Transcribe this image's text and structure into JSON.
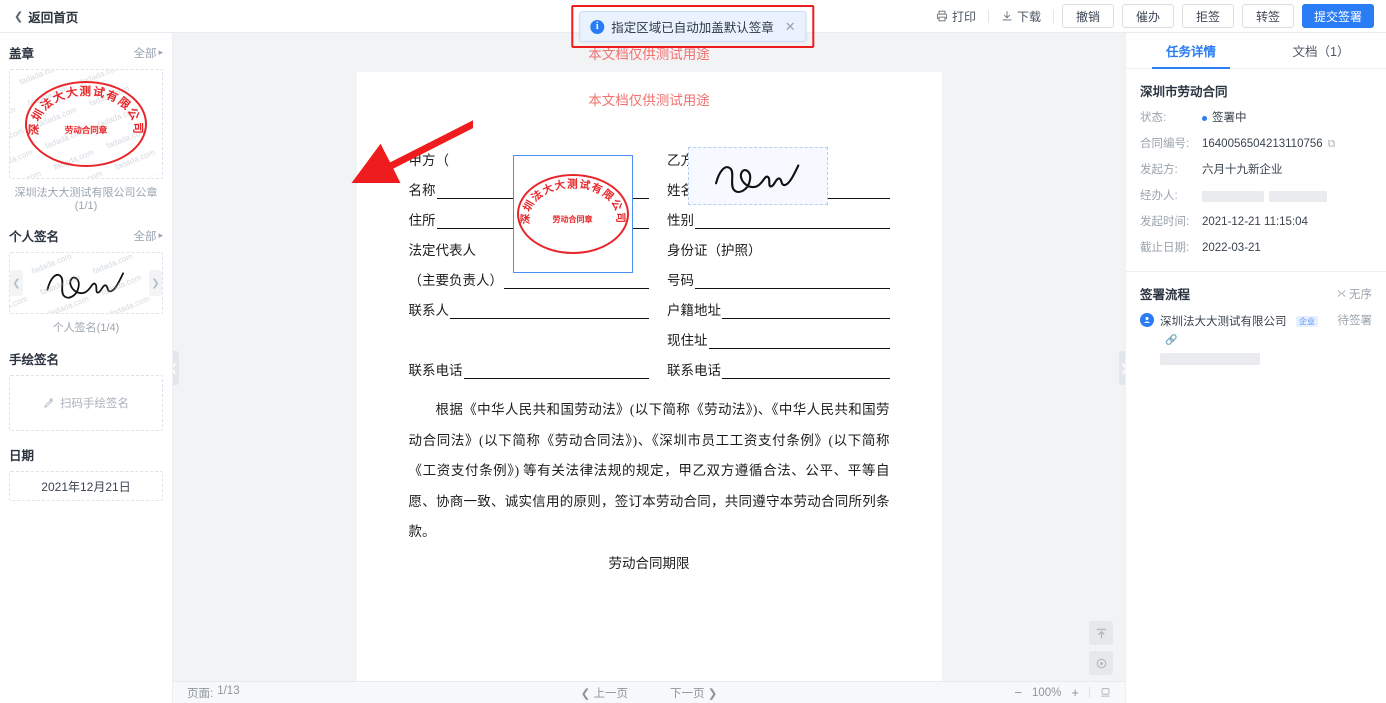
{
  "topbar": {
    "back_label": "返回首页",
    "print_label": "打印",
    "download_label": "下载",
    "buttons": [
      {
        "label": "撤销",
        "primary": false
      },
      {
        "label": "催办",
        "primary": false
      },
      {
        "label": "拒签",
        "primary": false
      },
      {
        "label": "转签",
        "primary": false
      },
      {
        "label": "提交签署",
        "primary": true
      }
    ]
  },
  "toast": {
    "message": "指定区域已自动加盖默认签章",
    "close": "✕",
    "info": "i",
    "border_color": "#ee1c1c"
  },
  "left_panel": {
    "seal_section": {
      "title": "盖章",
      "all": "全部",
      "caption": "深圳法大大测试有限公司公章(1/1)"
    },
    "seal": {
      "top_text": "深圳法大大测试有限公司",
      "center_text": "劳动合同章",
      "color": "#e8262a"
    },
    "signature_section": {
      "title": "个人签名",
      "all": "全部",
      "caption": "个人签名(1/4)"
    },
    "handdraw_section": {
      "title": "手绘签名",
      "action_label": "扫码手绘签名"
    },
    "date_section": {
      "title": "日期",
      "value": "2021年12月21日"
    },
    "watermark": "fadada.com"
  },
  "viewer": {
    "watermark_top": "本文档仅供测试用途",
    "watermark_page": "本文档仅供测试用途",
    "doc": {
      "left_column": [
        {
          "label": "甲方（",
          "line": false
        },
        {
          "label": "名称",
          "line": true
        },
        {
          "label": "住所",
          "line": true
        },
        {
          "label": "法定代表人",
          "line": false
        },
        {
          "label": "（主要负责人）",
          "line": true
        },
        {
          "label": "联系人",
          "line": true
        },
        {
          "label": "",
          "line": false
        },
        {
          "label": "联系电话",
          "line": true
        }
      ],
      "right_column": [
        {
          "label": "乙方(员工)",
          "line": false
        },
        {
          "label": "姓名",
          "line": true
        },
        {
          "label": "性别",
          "line": true
        },
        {
          "label": "身份证（护照）",
          "line": false
        },
        {
          "label": "号码",
          "line": true
        },
        {
          "label": "户籍地址",
          "line": true
        },
        {
          "label": "现住址",
          "line": true
        },
        {
          "label": "联系电话",
          "line": true
        }
      ],
      "paragraph": "根据《中华人民共和国劳动法》(以下简称《劳动法》)、《中华人民共和国劳动合同法》(以下简称《劳动合同法》)、《深圳市员工工资支付条例》(以下简称《工资支付条例》) 等有关法律法规的规定，甲乙双方遵循合法、公平、平等自愿、协商一致、诚实信用的原则，签订本劳动合同，共同遵守本劳动合同所列条款。",
      "next_heading": "劳动合同期限"
    },
    "float_buttons": [
      {
        "name": "scroll-top",
        "glyph": "⬆"
      },
      {
        "name": "locate",
        "glyph": "◎"
      }
    ]
  },
  "bottombar": {
    "page_label": "页面:",
    "page_value": "1/13",
    "prev_label": "上一页",
    "next_label": "下一页",
    "zoom_out": "−",
    "zoom_value": "100%",
    "zoom_in": "+",
    "fit_icon": "⎙"
  },
  "right_panel": {
    "tabs": [
      {
        "label": "任务详情",
        "active": true
      },
      {
        "label": "文档（1）",
        "active": false
      }
    ],
    "doc_title": "深圳市劳动合同",
    "details": [
      {
        "key": "状态:",
        "value": "签署中",
        "type": "status"
      },
      {
        "key": "合同编号:",
        "value": "1640056504213110756",
        "type": "copyable"
      },
      {
        "key": "发起方:",
        "value": "六月十九新企业",
        "type": "text"
      },
      {
        "key": "经办人:",
        "value": "",
        "type": "masked"
      },
      {
        "key": "发起时间:",
        "value": "2021-12-21 11:15:04",
        "type": "text"
      },
      {
        "key": "截止日期:",
        "value": "2022-03-21",
        "type": "text"
      }
    ],
    "flow": {
      "title": "签署流程",
      "order_label": "无序",
      "items": [
        {
          "name": "深圳法大大测试有限公司",
          "badge": "企业",
          "status": "待签署"
        }
      ]
    }
  },
  "colors": {
    "primary": "#2a7df4",
    "seal_red": "#e8262a",
    "annotation_red": "#ee1c1c",
    "watermark_red": "#f2706e"
  }
}
